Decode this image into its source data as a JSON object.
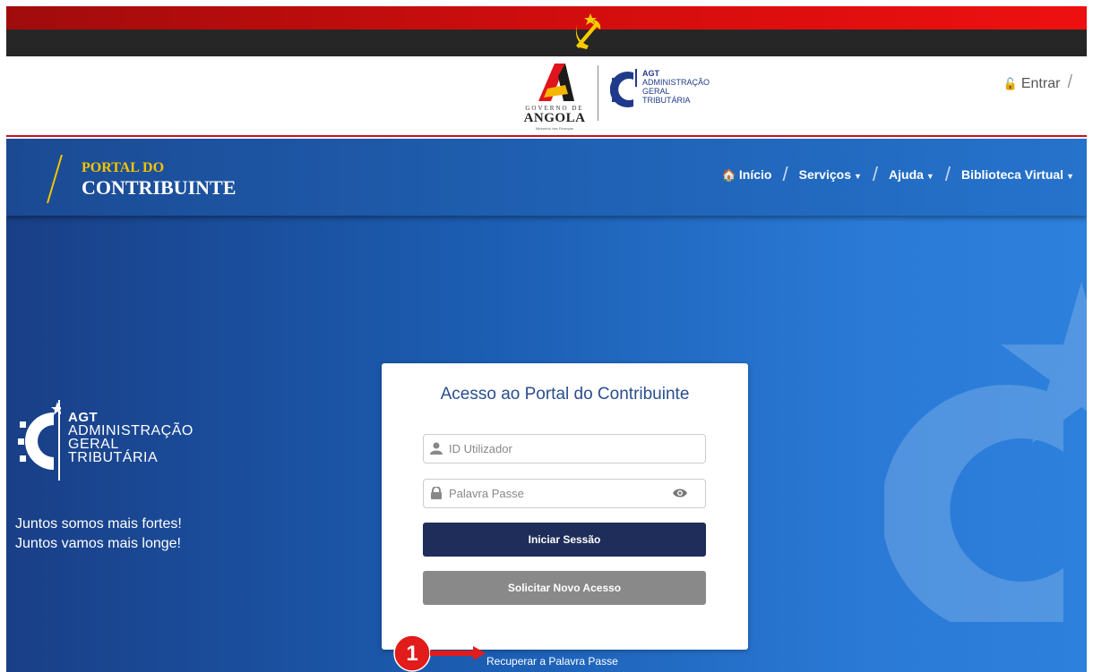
{
  "government": {
    "line1": "GOVERNO DE",
    "line2": "ANGOLA",
    "line3": "Ministério das Finanças"
  },
  "agt": {
    "abbr": "AGT",
    "line1": "ADMINISTRAÇÃO",
    "line2": "GERAL",
    "line3": "TRIBUTÁRIA"
  },
  "header": {
    "login_label": "Entrar",
    "separator": "/"
  },
  "brand": {
    "line1": "PORTAL DO",
    "line2": "CONTRIBUINTE"
  },
  "nav": {
    "separator": "/",
    "items": [
      {
        "label": "Início",
        "icon": "home-icon"
      },
      {
        "label": "Serviços",
        "icon": "caret-down-icon"
      },
      {
        "label": "Ajuda",
        "icon": "caret-down-icon"
      },
      {
        "label": "Biblioteca Virtual",
        "icon": "caret-down-icon"
      }
    ]
  },
  "slogan": {
    "line1": "Juntos somos mais fortes!",
    "line2": "Juntos vamos mais longe!"
  },
  "login": {
    "title": "Acesso ao Portal do Contribuinte",
    "user_placeholder": "ID Utilizador",
    "password_placeholder": "Palavra Passe",
    "submit_label": "Iniciar Sessão",
    "request_label": "Solicitar Novo Acesso",
    "recover_label": "Recuperar a Palavra Passe"
  },
  "annotation": {
    "number": "1"
  },
  "colors": {
    "flag_red": "#d00d0d",
    "flag_black": "#262626",
    "brand_yellow": "#f4c400",
    "hero_blue": "#1c5eb3",
    "primary_button": "#1f2d5a",
    "secondary_button": "#898989",
    "annotation_red": "#e21b1b"
  }
}
